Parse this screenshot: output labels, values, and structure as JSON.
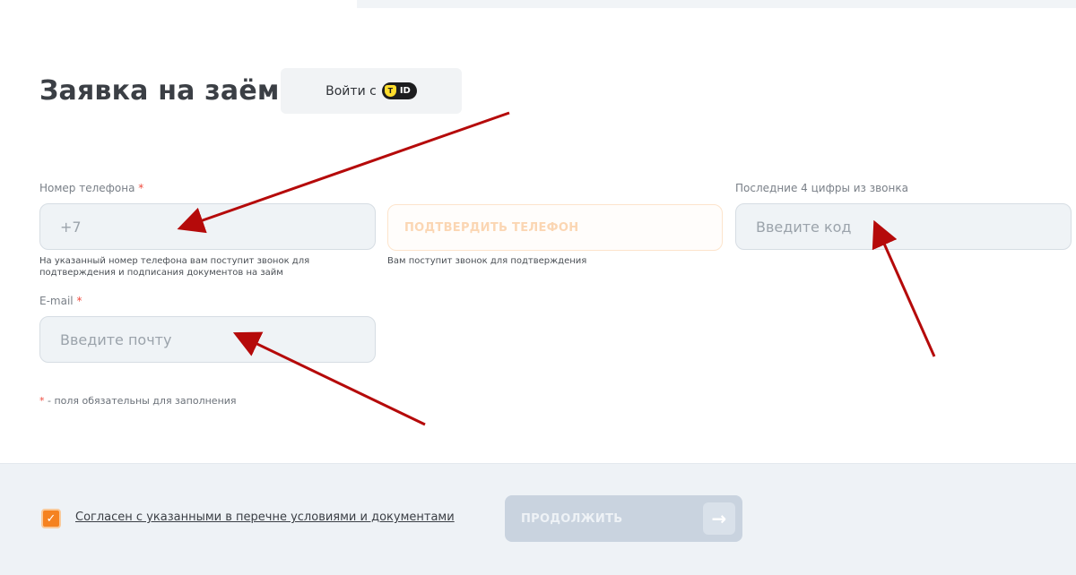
{
  "header": {
    "title": "Заявка на заём"
  },
  "tid_login": {
    "label": "Войти с",
    "badge_text": "ID",
    "shield_glyph": "T"
  },
  "phone": {
    "label": "Номер телефона",
    "required_mark": "*",
    "placeholder": "+7",
    "hint": "На указанный номер телефона вам поступит звонок для подтверждения и подписания документов на займ"
  },
  "confirm": {
    "label": "ПОДТВЕРДИТЬ ТЕЛЕФОН",
    "hint": "Вам поступит звонок для подтверждения"
  },
  "code": {
    "label": "Последние 4 цифры из звонка",
    "placeholder": "Введите код"
  },
  "email": {
    "label": "E-mail",
    "required_mark": "*",
    "placeholder": "Введите почту"
  },
  "required_note": {
    "mark": "*",
    "text": " - поля обязательны для заполнения"
  },
  "footer": {
    "agree_text": "Согласен с указанными в перечне условиями и документами",
    "checkbox_checked": true,
    "continue_label": "ПРОДОЛЖИТЬ"
  },
  "colors": {
    "accent": "#f58220",
    "arrow": "#b50a0a",
    "field_bg": "#eff3f6"
  }
}
